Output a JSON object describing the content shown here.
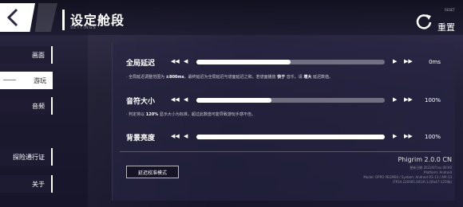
{
  "header": {
    "title": "设定舱段",
    "subtitle": "SETTINGS",
    "reset_en": "RESET",
    "reset_label": "重置"
  },
  "nav": {
    "items": [
      {
        "label": "画面"
      },
      {
        "label": "游玩"
      },
      {
        "label": "音频"
      },
      {
        "label": "探险通行证"
      },
      {
        "label": "关于"
      }
    ]
  },
  "settings": {
    "latency": {
      "label": "全局延迟",
      "value": "0ms",
      "level": 0.5,
      "note_pre": "· 全局延迟调整范围为 ",
      "note_range": "±800ms",
      "note_mid": "，最终延迟为全局延迟与谱面延迟之和。若谱面播放 ",
      "note_fast": "快于",
      "note_mid2": " 音乐，请 ",
      "note_inc": "增大",
      "note_end": " 延迟数值。"
    },
    "note_size": {
      "label": "音符大小",
      "value": "100%",
      "level": 0.4,
      "note_pre": "· 判定将以 ",
      "note_val": "120%",
      "note_end": " 显示大小为标准，超过此数值可能导致游玩手感不佳。"
    },
    "brightness": {
      "label": "背景亮度",
      "value": "100%",
      "level": 1.0
    }
  },
  "calibration_button": "延迟校准模式",
  "version": {
    "title": "Phigrim 2.0.0 CN",
    "lines": [
      "更新日期 2022/07/xx 00:00",
      "Platform: Android",
      "Model: OPPO PEGM00 / System: Android OS 13 / API-33",
      "(TP1A.220905.001/R.1c5fe47-1259b)"
    ]
  },
  "colors": {
    "accent": "#ffffff",
    "panel": "#2a2846"
  }
}
